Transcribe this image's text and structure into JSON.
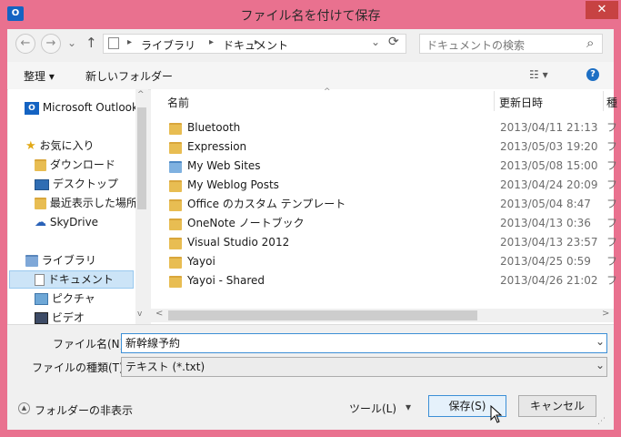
{
  "window": {
    "title": "ファイル名を付けて保存",
    "app_icon_text": "O",
    "close_glyph": "✕"
  },
  "nav": {
    "back_glyph": "←",
    "forward_glyph": "→",
    "recent_glyph": "⌄",
    "up_glyph": "↑",
    "breadcrumb": [
      "ライブラリ",
      "ドキュメント"
    ],
    "separator": "▸",
    "refresh_glyph": "⟳",
    "dropdown_glyph": "⌄",
    "search_placeholder": "ドキュメントの検索",
    "search_glyph": "⌕"
  },
  "toolbar": {
    "organize": "整理 ▾",
    "new_folder": "新しいフォルダー",
    "view_glyph": "☷ ▾",
    "help_glyph": "?"
  },
  "sidebar": {
    "items": [
      {
        "label": "Microsoft Outlook",
        "icon": "outlook-icon"
      },
      {
        "label": "お気に入り",
        "icon": "star-icon"
      },
      {
        "label": "ダウンロード",
        "icon": "download-folder-icon"
      },
      {
        "label": "デスクトップ",
        "icon": "desktop-icon"
      },
      {
        "label": "最近表示した場所",
        "icon": "recent-places-icon"
      },
      {
        "label": "SkyDrive",
        "icon": "cloud-icon"
      },
      {
        "label": "ライブラリ",
        "icon": "library-icon"
      },
      {
        "label": "ドキュメント",
        "icon": "document-icon"
      },
      {
        "label": "ピクチャ",
        "icon": "picture-icon"
      },
      {
        "label": "ビデオ",
        "icon": "video-icon"
      }
    ]
  },
  "files": {
    "columns": {
      "name": "名前",
      "modified": "更新日時",
      "type": "種"
    },
    "sort_glyph": "^",
    "rows": [
      {
        "name": "Bluetooth",
        "modified": "2013/04/11 21:13",
        "type": "フ"
      },
      {
        "name": "Expression",
        "modified": "2013/05/03 19:20",
        "type": "フ"
      },
      {
        "name": "My Web Sites",
        "modified": "2013/05/08 15:00",
        "type": "フ"
      },
      {
        "name": "My Weblog Posts",
        "modified": "2013/04/24 20:09",
        "type": "フ"
      },
      {
        "name": "Office のカスタム テンプレート",
        "modified": "2013/05/04 8:47",
        "type": "フ"
      },
      {
        "name": "OneNote ノートブック",
        "modified": "2013/04/13 0:36",
        "type": "フ"
      },
      {
        "name": "Visual Studio 2012",
        "modified": "2013/04/13 23:57",
        "type": "フ"
      },
      {
        "name": "Yayoi",
        "modified": "2013/04/25 0:59",
        "type": "フ"
      },
      {
        "name": "Yayoi - Shared",
        "modified": "2013/04/26 21:02",
        "type": "フ"
      }
    ]
  },
  "form": {
    "filename_label": "ファイル名(N):",
    "filename_value": "新幹線予約",
    "filetype_label": "ファイルの種類(T):",
    "filetype_value": "テキスト (*.txt)",
    "dropdown_glyph": "⌄"
  },
  "footer": {
    "hide_folders": "フォルダーの非表示",
    "tools": "ツール(L)",
    "tools_glyph": "▾",
    "save": "保存(S)",
    "cancel": "キャンセル"
  },
  "colors": {
    "frame": "#e9718f",
    "close": "#c74242",
    "folder": "#e8bd52",
    "selected": "#cce4f7"
  }
}
